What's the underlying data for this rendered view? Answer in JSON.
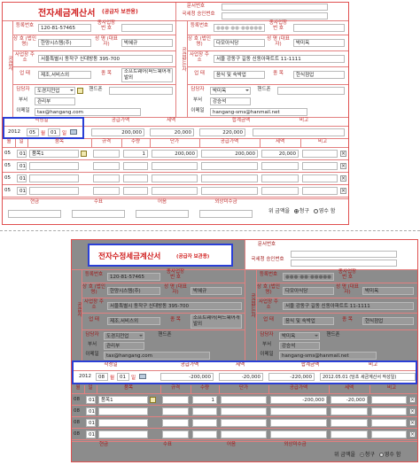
{
  "top": {
    "title": "전자세금계산서",
    "subtitle": "(공급자 보관용)",
    "doc_no_label": "문서번호",
    "nts_no_label": "국세청 승인번호",
    "supplier_side": "공급자",
    "buyer_side": "공급받는자",
    "s_reg_no_label": "등록번호",
    "s_reg_no": "120-81-57465",
    "s_branch_label": "종사업장 번 호",
    "s_name_label": "상 호 (법인명)",
    "s_name": "한양시스템(주)",
    "s_ceo_label": "성 명 (대표자)",
    "s_ceo": "박혜규",
    "s_addr_label": "사업장 주 소",
    "s_addr": "서울특별시 동작구 신대방동 395-700",
    "s_type_label": "업 태",
    "s_type": "제조,서비스외",
    "s_item_label": "종 목",
    "s_item": "소프트웨어(퍼드웨어개발외",
    "s_dept_label": "부서",
    "s_dept": "관리부",
    "s_mgr_label": "담당자",
    "s_mgr": "도경지전업",
    "s_phone_label": "핸드폰",
    "s_email_label": "이메일",
    "s_email": "tax@hangang.com",
    "b_reg_no_label": "등록번호",
    "b_reg_no": "(masked)",
    "b_branch_label": "종사업장 번 호",
    "b_name_label": "상 호 (법인명)",
    "b_name": "다모아식당",
    "b_ceo_label": "성 명 (대표자)",
    "b_ceo": "박미옥",
    "b_addr_label": "사업장 주 소",
    "b_addr": "서울 강동구 길동 신동아파트트 11-1111",
    "b_type_label": "업 태",
    "b_type": "음식 및 숙박업",
    "b_item_label": "종 목",
    "b_item": "한식점업",
    "b_mgr_label": "담당자",
    "b_mgr": "박미옥",
    "b_phone_label": "핸드폰",
    "b_dept_label": "부서",
    "b_dept": "강승석",
    "b_email_label": "이메일",
    "b_email": "hangang-sms@hanmail.net",
    "date_label": "작성일",
    "year": "2012",
    "month": "05",
    "month_unit": "월",
    "day": "01",
    "day_unit": "일",
    "supply_label": "공급가액",
    "supply": "200,000",
    "tax_label": "세액",
    "tax": "20,000",
    "total_label": "합계금액",
    "total": "220,000",
    "remark_label": "비고",
    "remark": "",
    "cols": [
      "월",
      "일",
      "품목",
      "규격",
      "수량",
      "단가",
      "공급가액",
      "세액",
      "비고"
    ],
    "rows": [
      {
        "m": "05",
        "d": "01",
        "item": "품목1",
        "qty": "1",
        "price": "200,000",
        "supply": "200,000",
        "tax": "20,000"
      },
      {
        "m": "05",
        "d": "01",
        "item": "",
        "qty": "",
        "price": "",
        "supply": "",
        "tax": ""
      },
      {
        "m": "05",
        "d": "01",
        "item": "",
        "qty": "",
        "price": "",
        "supply": "",
        "tax": ""
      },
      {
        "m": "05",
        "d": "01",
        "item": "",
        "qty": "",
        "price": "",
        "supply": "",
        "tax": ""
      }
    ],
    "pay_cols": [
      "현금",
      "수표",
      "어음",
      "외상미수금"
    ],
    "claim_text": "위 금액을",
    "claim_opt1": "청구",
    "claim_opt2": "영수 함"
  },
  "bottom": {
    "title": "전자수정세금계산서",
    "subtitle": "(공급자 보관용)",
    "doc_no_label": "문서번호",
    "nts_no_label": "국세청 승인번호",
    "s_reg_no": "120-81-57465",
    "s_name": "한양시스템(주)",
    "s_ceo": "박혜규",
    "s_addr": "서울특별시 동작구 신대방동 395-700",
    "s_type": "제조,서비스외",
    "s_item": "소프트웨어(퍼드웨어개발외",
    "s_dept": "관리부",
    "s_mgr": "도경지전업",
    "s_email": "tax@hangang.com",
    "b_reg_no": "(masked)",
    "b_name": "다모아식당",
    "b_ceo": "박미옥",
    "b_addr": "서울 강동구 길동 신동아파트트 11-1111",
    "b_type": "음식 및 숙박업",
    "b_item": "현식점업",
    "b_mgr": "박미옥",
    "b_dept": "강승석",
    "b_email": "hangang-sms@hanmail.net",
    "year": "2012",
    "month": "08",
    "day": "01",
    "supply": "-200,000",
    "tax": "-20,000",
    "total": "-220,000",
    "remark": "2012.05.01 (당초 세금계산서 작성일)",
    "rows": [
      {
        "m": "08",
        "d": "01",
        "item": "품목1",
        "qty": "1",
        "price": "",
        "supply": "-200,000",
        "tax": "-20,000"
      },
      {
        "m": "08",
        "d": "01",
        "item": "",
        "qty": "",
        "price": "",
        "supply": "",
        "tax": ""
      },
      {
        "m": "08",
        "d": "01",
        "item": "",
        "qty": "",
        "price": "",
        "supply": "",
        "tax": ""
      },
      {
        "m": "08",
        "d": "01",
        "item": "",
        "qty": "",
        "price": "",
        "supply": "",
        "tax": ""
      }
    ],
    "claim_text": "위 금액을",
    "claim_opt1": "청구",
    "claim_opt2": "영수 함"
  },
  "colors": {
    "border": "#e05050",
    "highlight": "#2a3fd6",
    "shade": "#8c8c8c"
  }
}
